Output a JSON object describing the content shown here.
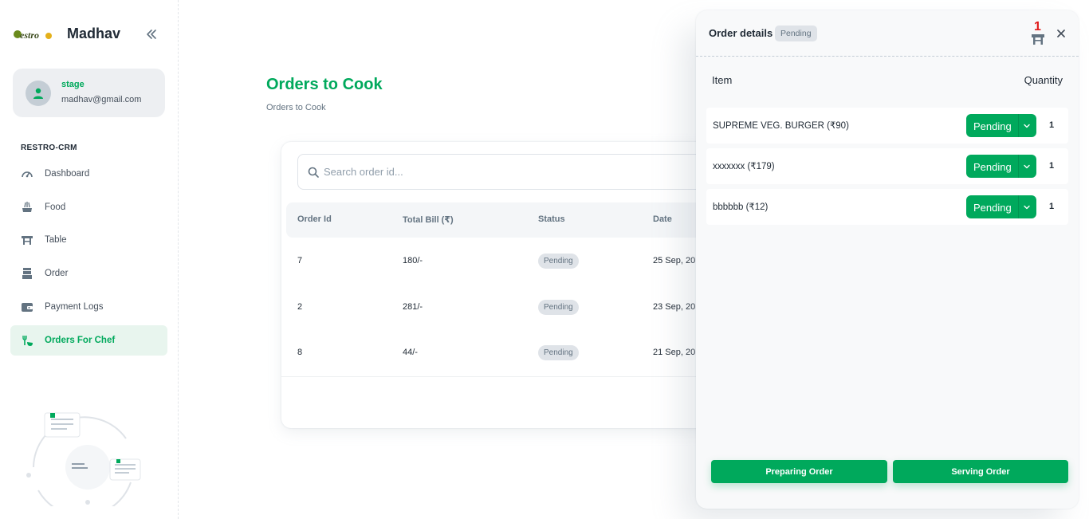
{
  "sidebar": {
    "logo_text": "Restro",
    "brand_name": "Madhav",
    "account": {
      "name": "stage",
      "email": "madhav@gmail.com"
    },
    "section_label": "RESTRO-CRM",
    "items": [
      {
        "label": "Dashboard",
        "icon": "dashboard-icon"
      },
      {
        "label": "Food",
        "icon": "food-icon"
      },
      {
        "label": "Table",
        "icon": "table-icon"
      },
      {
        "label": "Order",
        "icon": "order-icon"
      },
      {
        "label": "Payment Logs",
        "icon": "wallet-icon"
      },
      {
        "label": "Orders For Chef",
        "icon": "chef-icon",
        "active": true
      }
    ]
  },
  "main": {
    "title": "Orders to Cook",
    "breadcrumb": "Orders to Cook",
    "search": {
      "placeholder": "Search order id..."
    },
    "table": {
      "headers": [
        "Order Id",
        "Total Bill (₹)",
        "Status",
        "Date"
      ],
      "rows": [
        {
          "id": "7",
          "bill": "180/-",
          "status": "Pending",
          "date": "25 Sep, 20"
        },
        {
          "id": "2",
          "bill": "281/-",
          "status": "Pending",
          "date": "23 Sep, 20"
        },
        {
          "id": "8",
          "bill": "44/-",
          "status": "Pending",
          "date": "21 Sep, 20"
        }
      ]
    }
  },
  "drawer": {
    "title": "Order details",
    "status": "Pending",
    "table_number": "1",
    "columns": {
      "item": "Item",
      "quantity": "Quantity"
    },
    "items": [
      {
        "name": "SUPREME VEG. BURGER (₹90)",
        "status": "Pending",
        "qty": "1"
      },
      {
        "name": "xxxxxxx (₹179)",
        "status": "Pending",
        "qty": "1"
      },
      {
        "name": "bbbbbb (₹12)",
        "status": "Pending",
        "qty": "1"
      }
    ],
    "buttons": {
      "preparing": "Preparing Order",
      "serving": "Serving Order"
    }
  },
  "colors": {
    "accent": "#00a95c",
    "table_number": "#e01b1b",
    "badge_bg": "#dfe3e8"
  }
}
